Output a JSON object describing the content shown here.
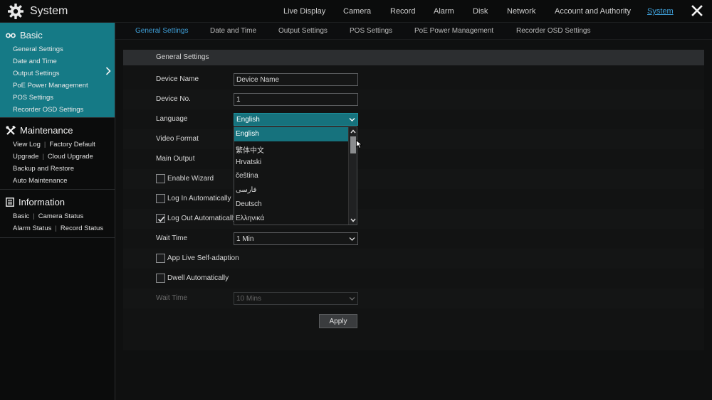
{
  "app": {
    "title": "System"
  },
  "topnav": [
    {
      "label": "Live Display",
      "active": false
    },
    {
      "label": "Camera",
      "active": false
    },
    {
      "label": "Record",
      "active": false
    },
    {
      "label": "Alarm",
      "active": false
    },
    {
      "label": "Disk",
      "active": false
    },
    {
      "label": "Network",
      "active": false
    },
    {
      "label": "Account and Authority",
      "active": false
    },
    {
      "label": "System",
      "active": true
    }
  ],
  "sidebar": {
    "basic": {
      "title": "Basic",
      "items": [
        "General Settings",
        "Date and Time",
        "Output Settings",
        "PoE Power Management",
        "POS Settings",
        "Recorder OSD Settings"
      ]
    },
    "maintenance": {
      "title": "Maintenance",
      "rows": [
        [
          "View Log",
          "Factory Default"
        ],
        [
          "Upgrade",
          "Cloud Upgrade"
        ],
        [
          "Backup and Restore"
        ],
        [
          "Auto Maintenance"
        ]
      ]
    },
    "information": {
      "title": "Information",
      "rows": [
        [
          "Basic",
          "Camera Status"
        ],
        [
          "Alarm Status",
          "Record Status"
        ]
      ]
    }
  },
  "tabs": [
    {
      "label": "General Settings",
      "active": true
    },
    {
      "label": "Date and Time",
      "active": false
    },
    {
      "label": "Output Settings",
      "active": false
    },
    {
      "label": "POS Settings",
      "active": false
    },
    {
      "label": "PoE Power Management",
      "active": false
    },
    {
      "label": "Recorder OSD Settings",
      "active": false
    }
  ],
  "panel": {
    "title": "General Settings",
    "device_name": {
      "label": "Device Name",
      "value": "Device Name"
    },
    "device_no": {
      "label": "Device No.",
      "value": "1"
    },
    "language": {
      "label": "Language",
      "value": "English"
    },
    "video_format": {
      "label": "Video Format"
    },
    "main_output": {
      "label": "Main Output"
    },
    "enable_wizard": {
      "label": "Enable Wizard",
      "checked": false
    },
    "log_in_auto": {
      "label": "Log In Automatically",
      "checked": false
    },
    "log_out_auto": {
      "label": "Log Out Automatically",
      "checked": true
    },
    "wait_time": {
      "label": "Wait Time",
      "value": "1 Min"
    },
    "app_live": {
      "label": "App Live Self-adaption",
      "checked": false
    },
    "dwell_auto": {
      "label": "Dwell Automatically",
      "checked": false
    },
    "dwell_wait_time": {
      "label": "Wait Time",
      "value": "10 Mins",
      "disabled": true
    },
    "apply_label": "Apply"
  },
  "language_dropdown": {
    "options": [
      "English",
      "繁体中文",
      "Hrvatski",
      "čeština",
      "فارسی",
      "Deutsch",
      "Ελληνικά"
    ],
    "selected": "English"
  },
  "colors": {
    "accent": "#16727d",
    "active_text": "#3fa0d9",
    "background": "#0e0f10"
  }
}
